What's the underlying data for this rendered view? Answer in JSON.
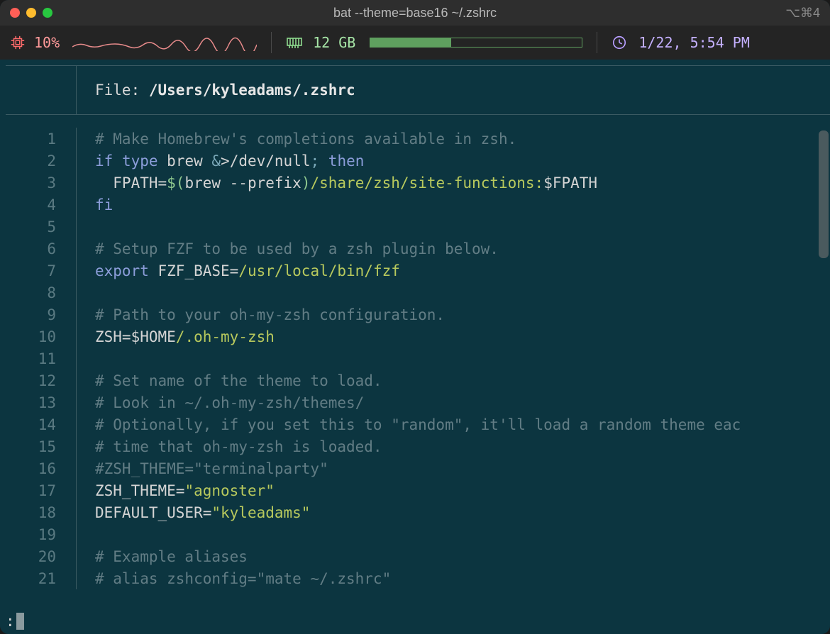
{
  "window": {
    "title": "bat --theme=base16 ~/.zshrc",
    "shortcut_hint": "⌥⌘4"
  },
  "status": {
    "cpu_percent": "10%",
    "memory": "12 GB",
    "datetime": "1/22, 5:54 PM"
  },
  "file": {
    "label": "File: ",
    "path": "/Users/kyleadams/.zshrc"
  },
  "lines": [
    {
      "n": "1",
      "segs": [
        {
          "c": "c-comment",
          "t": "# Make Homebrew's completions available in zsh."
        }
      ]
    },
    {
      "n": "2",
      "segs": [
        {
          "c": "c-kw",
          "t": "if"
        },
        {
          "c": "",
          "t": " "
        },
        {
          "c": "c-kw",
          "t": "type"
        },
        {
          "c": "",
          "t": " brew "
        },
        {
          "c": "c-cmd",
          "t": "&"
        },
        {
          "c": "",
          "t": ">/dev/null"
        },
        {
          "c": "c-cmd",
          "t": ";"
        },
        {
          "c": "",
          "t": " "
        },
        {
          "c": "c-kw",
          "t": "then"
        }
      ]
    },
    {
      "n": "3",
      "segs": [
        {
          "c": "",
          "t": "  FPATH="
        },
        {
          "c": "c-green",
          "t": "$("
        },
        {
          "c": "",
          "t": "brew --prefix"
        },
        {
          "c": "c-green",
          "t": ")"
        },
        {
          "c": "c-path",
          "t": "/share/zsh/site-functions:"
        },
        {
          "c": "",
          "t": "$FPATH"
        }
      ]
    },
    {
      "n": "4",
      "segs": [
        {
          "c": "c-kw",
          "t": "fi"
        }
      ]
    },
    {
      "n": "5",
      "segs": []
    },
    {
      "n": "6",
      "segs": [
        {
          "c": "c-comment",
          "t": "# Setup FZF to be used by a zsh plugin below."
        }
      ]
    },
    {
      "n": "7",
      "segs": [
        {
          "c": "c-kw",
          "t": "export"
        },
        {
          "c": "",
          "t": " FZF_BASE="
        },
        {
          "c": "c-path",
          "t": "/usr/local/bin/fzf"
        }
      ]
    },
    {
      "n": "8",
      "segs": []
    },
    {
      "n": "9",
      "segs": [
        {
          "c": "c-comment",
          "t": "# Path to your oh-my-zsh configuration."
        }
      ]
    },
    {
      "n": "10",
      "segs": [
        {
          "c": "",
          "t": "ZSH=$HOME"
        },
        {
          "c": "c-path",
          "t": "/.oh-my-zsh"
        }
      ]
    },
    {
      "n": "11",
      "segs": []
    },
    {
      "n": "12",
      "segs": [
        {
          "c": "c-comment",
          "t": "# Set name of the theme to load."
        }
      ]
    },
    {
      "n": "13",
      "segs": [
        {
          "c": "c-comment",
          "t": "# Look in ~/.oh-my-zsh/themes/"
        }
      ]
    },
    {
      "n": "14",
      "segs": [
        {
          "c": "c-comment",
          "t": "# Optionally, if you set this to \"random\", it'll load a random theme eac"
        }
      ]
    },
    {
      "n": "15",
      "segs": [
        {
          "c": "c-comment",
          "t": "# time that oh-my-zsh is loaded."
        }
      ]
    },
    {
      "n": "16",
      "segs": [
        {
          "c": "c-comment",
          "t": "#ZSH_THEME=\"terminalparty\""
        }
      ]
    },
    {
      "n": "17",
      "segs": [
        {
          "c": "",
          "t": "ZSH_THEME="
        },
        {
          "c": "c-str",
          "t": "\"agnoster\""
        }
      ]
    },
    {
      "n": "18",
      "segs": [
        {
          "c": "",
          "t": "DEFAULT_USER="
        },
        {
          "c": "c-str",
          "t": "\"kyleadams\""
        }
      ]
    },
    {
      "n": "19",
      "segs": []
    },
    {
      "n": "20",
      "segs": [
        {
          "c": "c-comment",
          "t": "# Example aliases"
        }
      ]
    },
    {
      "n": "21",
      "segs": [
        {
          "c": "c-comment",
          "t": "# alias zshconfig=\"mate ~/.zshrc\""
        }
      ]
    }
  ],
  "prompt": ":"
}
